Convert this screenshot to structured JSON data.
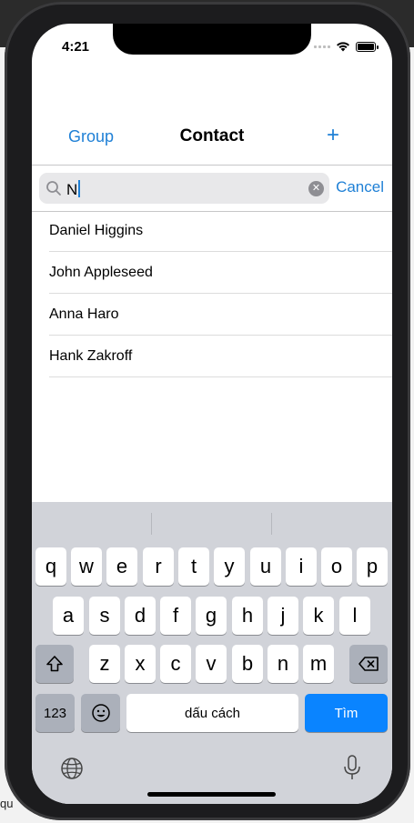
{
  "status_bar": {
    "time": "4:21"
  },
  "nav": {
    "left_label": "Group",
    "title": "Contact",
    "add_label": "+"
  },
  "search": {
    "value": "N",
    "cancel_label": "Cancel"
  },
  "contacts": [
    {
      "name": "Daniel Higgins"
    },
    {
      "name": "John Appleseed"
    },
    {
      "name": "Anna Haro"
    },
    {
      "name": "Hank Zakroff"
    }
  ],
  "keyboard": {
    "row1": [
      "q",
      "w",
      "e",
      "r",
      "t",
      "y",
      "u",
      "i",
      "o",
      "p"
    ],
    "row2": [
      "a",
      "s",
      "d",
      "f",
      "g",
      "h",
      "j",
      "k",
      "l"
    ],
    "row3": [
      "z",
      "x",
      "c",
      "v",
      "b",
      "n",
      "m"
    ],
    "numbers_label": "123",
    "space_label": "dấu cách",
    "return_label": "Tìm",
    "shift_icon": "shift-icon",
    "delete_icon": "delete-icon",
    "emoji_icon": "emoji-icon"
  },
  "background_text": {
    "bottom_left": "qu"
  },
  "colors": {
    "accent": "#1f80d6",
    "go_key": "#0a84ff"
  }
}
